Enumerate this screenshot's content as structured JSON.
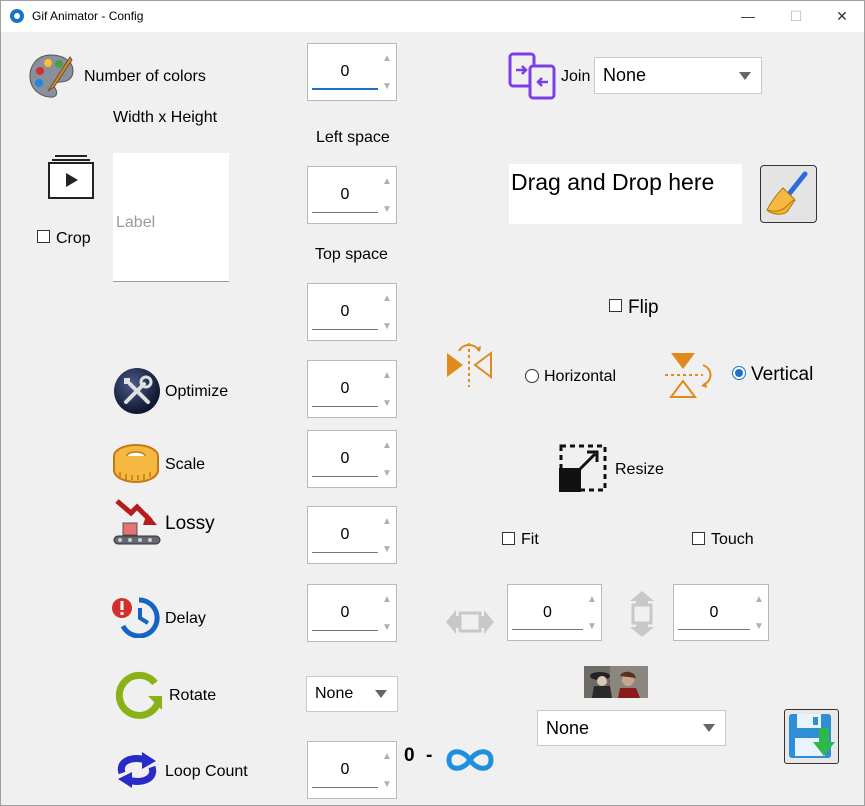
{
  "window": {
    "title": "Gif Animator - Config",
    "minimize": "—",
    "maximize": "☐",
    "close": "✕"
  },
  "colors": {
    "number_label": "Number of colors",
    "value": "0"
  },
  "size": {
    "width_height_label": "Width x Height",
    "preview_label": "Label"
  },
  "crop": {
    "label": "Crop"
  },
  "left_space": {
    "label": "Left space",
    "value": "0"
  },
  "top_space": {
    "label": "Top space",
    "value": "0"
  },
  "top_space_value": "0",
  "optimize": {
    "label": "Optimize",
    "value": "0"
  },
  "scale": {
    "label": "Scale",
    "value": "0"
  },
  "lossy": {
    "label": "Lossy",
    "value": "0"
  },
  "delay": {
    "label": "Delay",
    "value": "0"
  },
  "rotate": {
    "label": "Rotate",
    "selected": "None"
  },
  "loop": {
    "label": "Loop Count",
    "value": "0",
    "range_start": "0",
    "range_dash": "-"
  },
  "join": {
    "label": "Join",
    "selected": "None"
  },
  "dropzone": {
    "text": "Drag and Drop here"
  },
  "flip": {
    "label": "Flip",
    "horizontal": "Horizontal",
    "vertical": "Vertical"
  },
  "resize": {
    "label": "Resize",
    "fit": "Fit",
    "touch": "Touch",
    "width_value": "0",
    "height_value": "0"
  },
  "bottom_select": {
    "selected": "None"
  },
  "icons": {
    "palette": "palette-icon",
    "crop": "film-frame-icon",
    "optimize": "wrench-screwdriver-icon",
    "scale": "tape-measure-icon",
    "lossy": "down-trend-conveyor-icon",
    "delay": "clock-alert-icon",
    "rotate": "rotate-arrow-icon",
    "loop": "loop-arrows-icon",
    "infinity": "infinity-icon",
    "join": "join-files-icon",
    "clear": "broom-icon",
    "flip_h": "flip-horizontal-icon",
    "flip_v": "flip-vertical-icon",
    "resize": "resize-icon",
    "width": "horizontal-resize-icon",
    "height": "vertical-resize-icon",
    "thumbnail": "photo-thumbnail-icon",
    "save": "save-download-icon"
  },
  "accent": "#1a73c8"
}
